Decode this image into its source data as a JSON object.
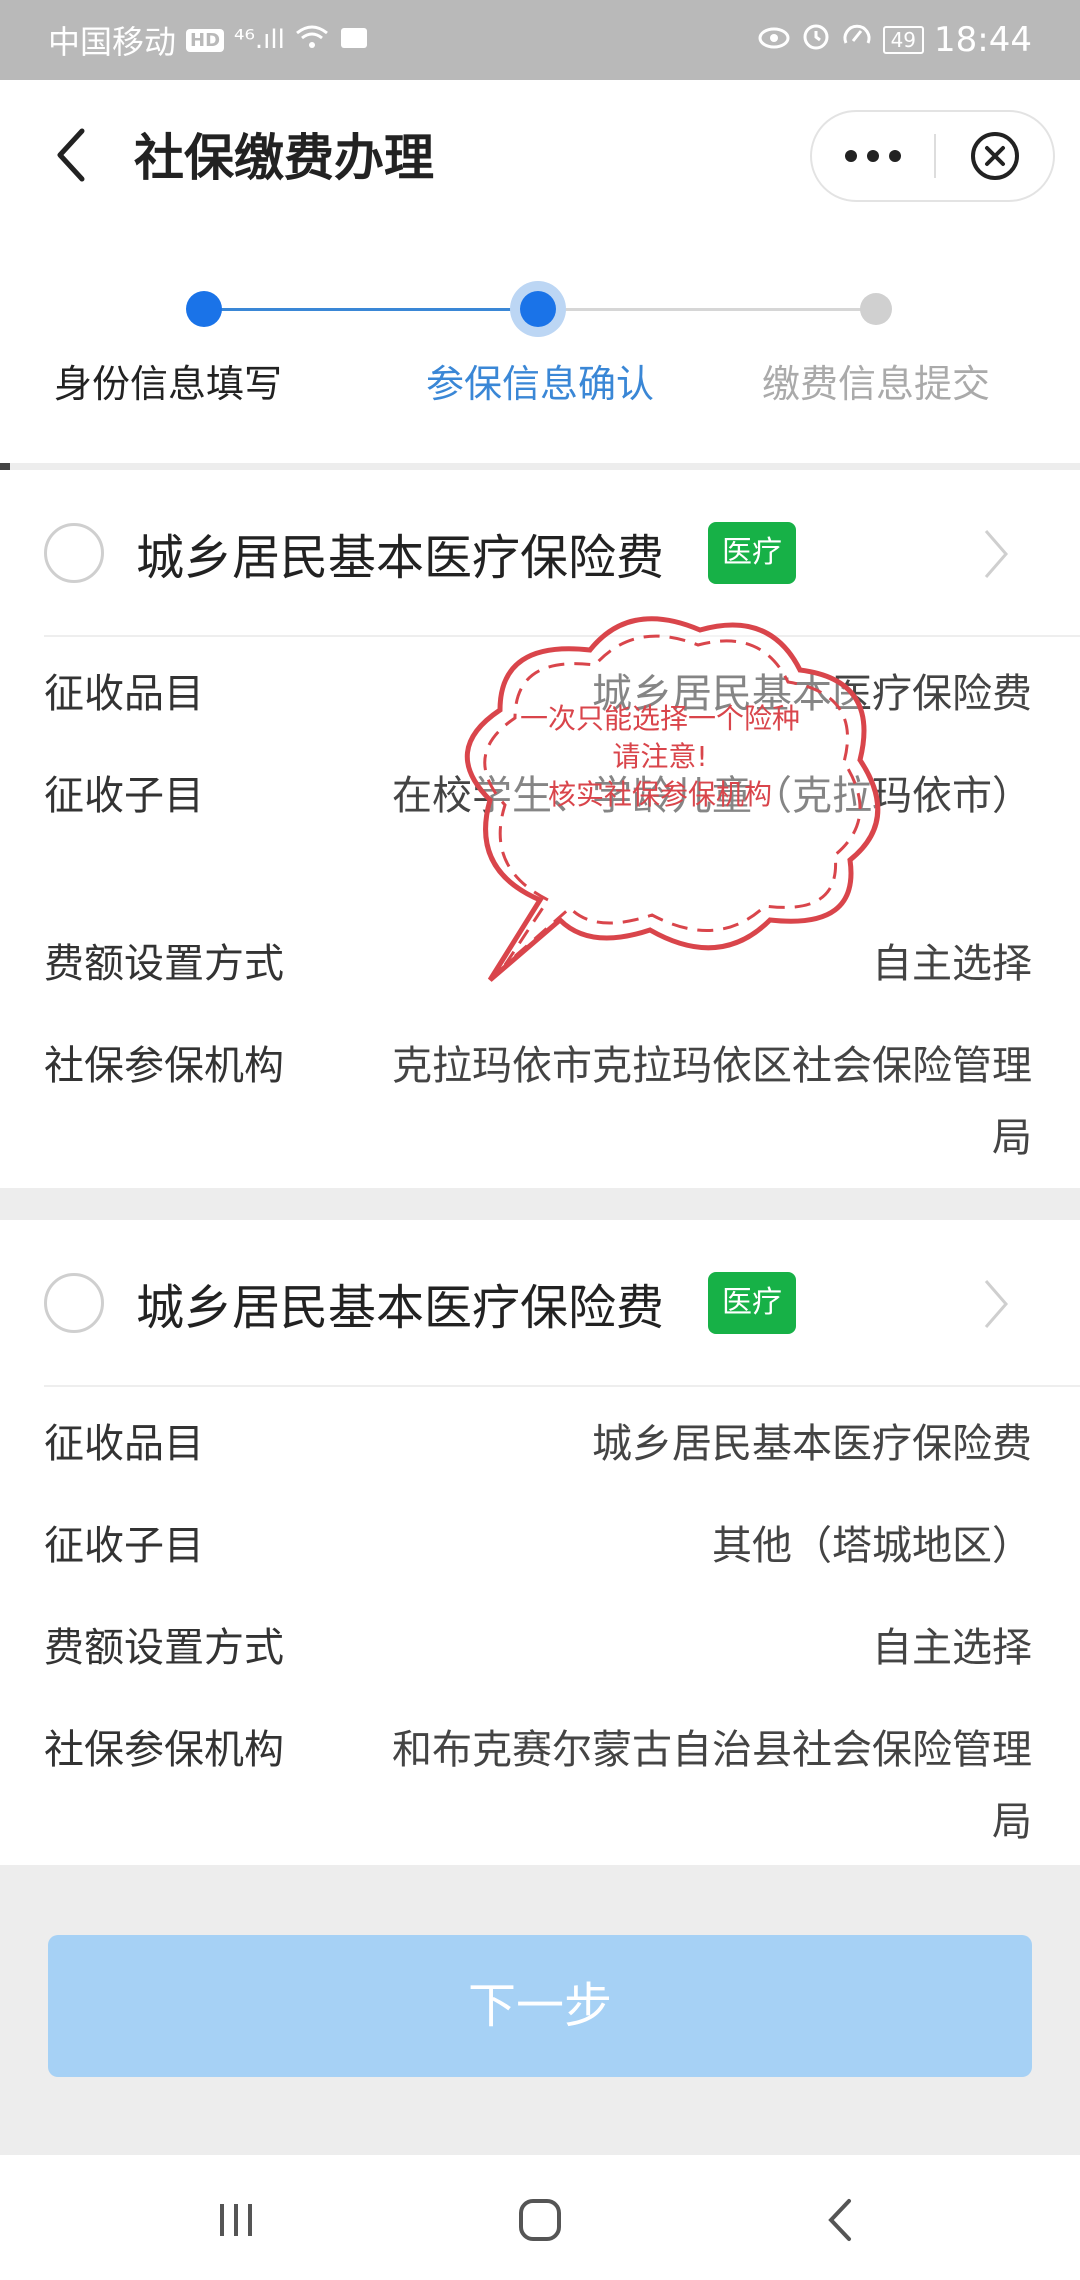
{
  "statusbar": {
    "carrier": "中国移动",
    "hd_badge": "HD",
    "signal": "⁴⁶.ıll",
    "battery": "49",
    "time": "18:44"
  },
  "navbar": {
    "title": "社保缴费办理"
  },
  "steps": [
    {
      "label": "身份信息填写",
      "state": "done"
    },
    {
      "label": "参保信息确认",
      "state": "active"
    },
    {
      "label": "缴费信息提交",
      "state": "pending"
    }
  ],
  "cards": [
    {
      "title": "城乡居民基本医疗保险费",
      "tag": "医疗",
      "rows": [
        {
          "key": "征收品目",
          "value": "城乡居民基本医疗保险费"
        },
        {
          "key": "征收子目",
          "value": "在校学生、学龄儿童（克拉玛依市）"
        },
        {
          "key": "费额设置方式",
          "value": "自主选择"
        },
        {
          "key": "社保参保机构",
          "value": "克拉玛依市克拉玛依区社会保险管理局"
        }
      ]
    },
    {
      "title": "城乡居民基本医疗保险费",
      "tag": "医疗",
      "rows": [
        {
          "key": "征收品目",
          "value": "城乡居民基本医疗保险费"
        },
        {
          "key": "征收子目",
          "value": "其他（塔城地区）"
        },
        {
          "key": "费额设置方式",
          "value": "自主选择"
        },
        {
          "key": "社保参保机构",
          "value": "和布克赛尔蒙古自治县社会保险管理局"
        }
      ]
    }
  ],
  "annotation": {
    "lines": [
      "一次只能选择一个险种",
      "请注意!",
      "核实社保参保机构"
    ],
    "color": "#d9454b"
  },
  "footer": {
    "next_label": "下一步"
  },
  "colors": {
    "primary": "#1a73e8",
    "tag_green": "#17b147",
    "button_disabled": "#a6d1f5"
  }
}
